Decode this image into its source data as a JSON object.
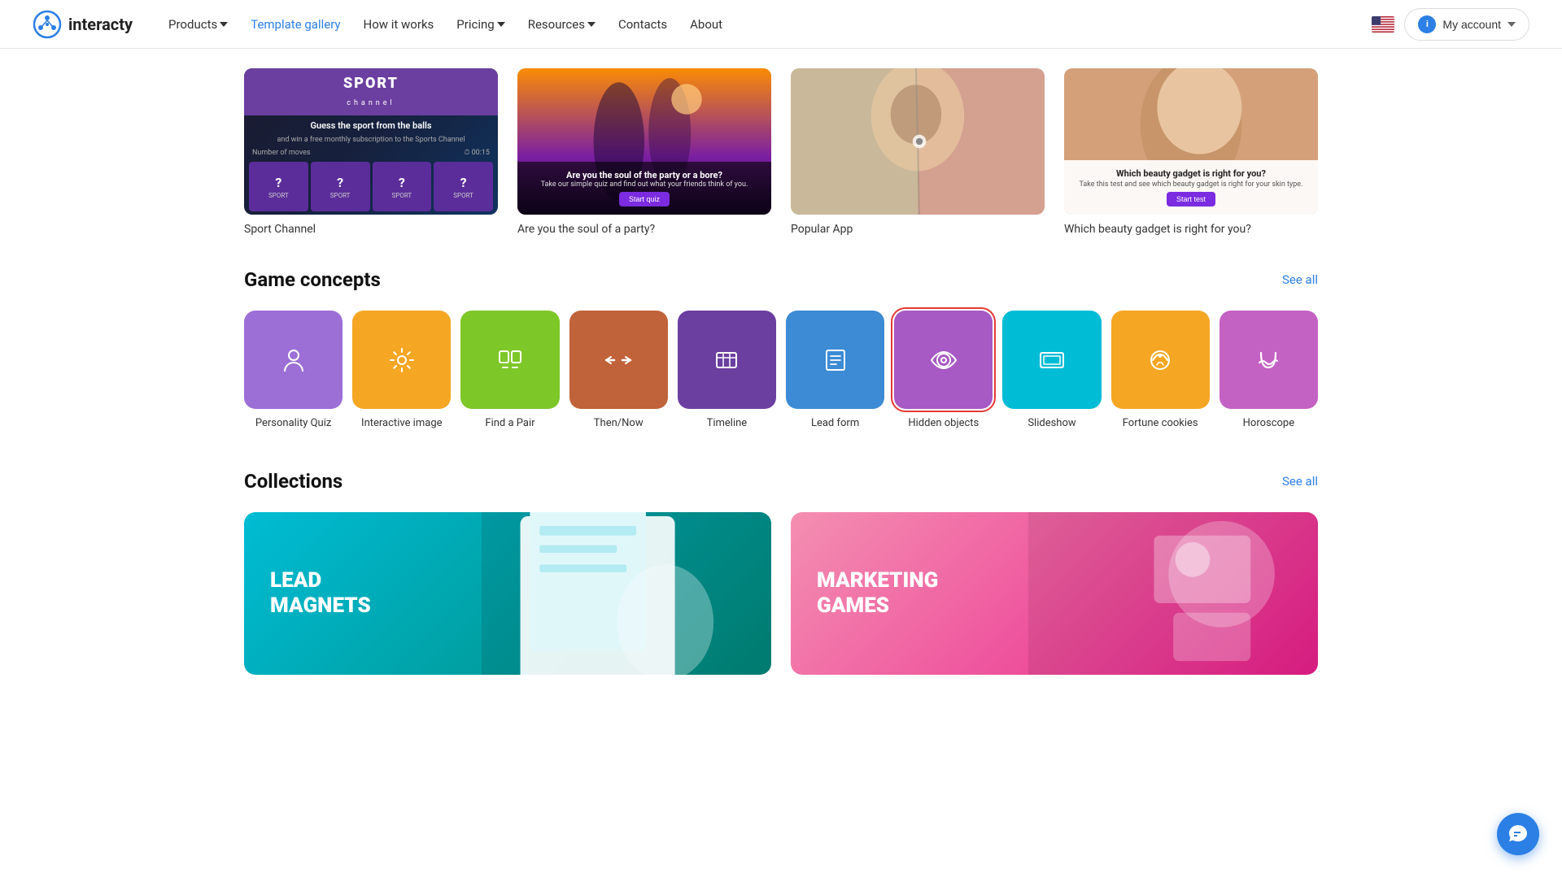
{
  "nav": {
    "logo_text": "interacty",
    "links": [
      {
        "label": "Products",
        "has_arrow": true,
        "active": false
      },
      {
        "label": "Template gallery",
        "has_arrow": false,
        "active": true
      },
      {
        "label": "How it works",
        "has_arrow": false,
        "active": false
      },
      {
        "label": "Pricing",
        "has_arrow": true,
        "active": false
      },
      {
        "label": "Resources",
        "has_arrow": true,
        "active": false
      },
      {
        "label": "Contacts",
        "has_arrow": false,
        "active": false
      },
      {
        "label": "About",
        "has_arrow": false,
        "active": false
      }
    ],
    "my_account": "My account"
  },
  "top_cards": [
    {
      "label": "Sport Channel",
      "type": "sport"
    },
    {
      "label": "Are you the soul of a party?",
      "type": "party"
    },
    {
      "label": "Popular App",
      "type": "popular"
    },
    {
      "label": "Which beauty gadget is right for you?",
      "type": "beauty"
    }
  ],
  "game_concepts": {
    "title": "Game concepts",
    "see_all": "See all",
    "items": [
      {
        "label": "Personality Quiz",
        "color": "#9c6fd6",
        "icon": "person"
      },
      {
        "label": "Interactive image",
        "color": "#f5a623",
        "icon": "image"
      },
      {
        "label": "Find a Pair",
        "color": "#7ec728",
        "icon": "pair"
      },
      {
        "label": "Then/Now",
        "color": "#c0633a",
        "icon": "thennow"
      },
      {
        "label": "Timeline",
        "color": "#6b3fa0",
        "icon": "timeline"
      },
      {
        "label": "Lead form",
        "color": "#3d8bd4",
        "icon": "form"
      },
      {
        "label": "Hidden objects",
        "color": "#a759c4",
        "icon": "hidden",
        "selected": true
      },
      {
        "label": "Slideshow",
        "color": "#00bcd4",
        "icon": "slideshow"
      },
      {
        "label": "Fortune cookies",
        "color": "#f5a623",
        "icon": "fortune"
      },
      {
        "label": "Horoscope",
        "color": "#c462c4",
        "icon": "horoscope"
      }
    ]
  },
  "collections": {
    "title": "Collections",
    "see_all": "See all",
    "items": [
      {
        "label": "LEAD\nMAGNETS",
        "type": "teal"
      },
      {
        "label": "MARKETING\nGAMES",
        "type": "pink"
      }
    ]
  }
}
